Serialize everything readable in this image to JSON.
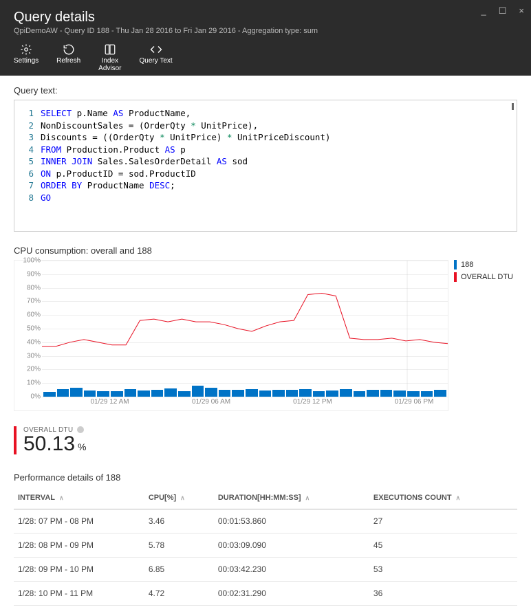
{
  "window": {
    "min": "_",
    "max": "☐",
    "close": "×"
  },
  "header": {
    "title": "Query details",
    "subtitle": "QpiDemoAW - Query ID 188 - Thu Jan 28 2016 to Fri Jan 29 2016 - Aggregation type: sum"
  },
  "toolbar": {
    "settings": "Settings",
    "refresh": "Refresh",
    "index_advisor_l1": "Index",
    "index_advisor_l2": "Advisor",
    "query_text": "Query Text"
  },
  "query_label": "Query text:",
  "code": {
    "l1a": "SELECT",
    "l1b": " p.Name ",
    "l1c": "AS",
    "l1d": " ProductName,",
    "l2a": "    NonDiscountSales = (OrderQty ",
    "l2b": "*",
    "l2c": " UnitPrice),",
    "l3a": "    Discounts = ((OrderQty ",
    "l3b": "*",
    "l3c": " UnitPrice) ",
    "l3d": "*",
    "l3e": " UnitPriceDiscount)",
    "l4a": "FROM",
    "l4b": " Production.Product ",
    "l4c": "AS",
    "l4d": " p",
    "l5a": "INNER JOIN",
    "l5b": " Sales.SalesOrderDetail ",
    "l5c": "AS",
    "l5d": " sod",
    "l6a": "ON",
    "l6b": " p.ProductID = sod.ProductID",
    "l7a": "ORDER BY",
    "l7b": " ProductName ",
    "l7c": "DESC",
    "l7d": ";",
    "l8a": "GO",
    "n1": "1",
    "n2": "2",
    "n3": "3",
    "n4": "4",
    "n5": "5",
    "n6": "6",
    "n7": "7",
    "n8": "8"
  },
  "chart_title": "CPU consumption: overall and 188",
  "legend": {
    "s1_name": "188",
    "s1_color": "#0073c6",
    "s2_name": "OVERALL DTU",
    "s2_color": "#e81123"
  },
  "chart_data": {
    "type": "bar+line",
    "ylabel": "",
    "ylim": [
      0,
      100
    ],
    "x_tick_labels": [
      "01/29 12 AM",
      "01/29 06 AM",
      "01/29 12 PM",
      "01/29 06 PM"
    ],
    "x_tick_positions_pct": [
      16.7,
      41.7,
      66.7,
      91.7
    ],
    "series": [
      {
        "name": "188",
        "type": "bar",
        "values": [
          3.5,
          5.8,
          6.8,
          4.7,
          3.9,
          4.2,
          5.5,
          4.8,
          5.1,
          6.0,
          4.0,
          7.9,
          6.5,
          5.0,
          5.2,
          5.8,
          4.4,
          5.0,
          5.2,
          5.4,
          3.8,
          4.6,
          5.5,
          4.3,
          5.0,
          5.3,
          4.5,
          3.8,
          4.2,
          5.0
        ]
      },
      {
        "name": "OVERALL DTU",
        "type": "line",
        "values": [
          37,
          37,
          40,
          42,
          40,
          38,
          38,
          56,
          57,
          55,
          57,
          55,
          55,
          53,
          50,
          48,
          52,
          55,
          56,
          75,
          76,
          74,
          43,
          42,
          42,
          43,
          41,
          42,
          40,
          39
        ]
      }
    ]
  },
  "big_stat": {
    "label": "OVERALL DTU",
    "value": "50.13",
    "suffix": " %"
  },
  "perf_title": "Performance details of 188",
  "perf_headers": {
    "interval": "INTERVAL",
    "cpu": "CPU[%]",
    "duration": "DURATION[HH:MM:SS]",
    "exec": "EXECUTIONS COUNT"
  },
  "perf_rows": [
    {
      "interval": "1/28: 07 PM - 08 PM",
      "cpu": "3.46",
      "duration": "00:01:53.860",
      "exec": "27"
    },
    {
      "interval": "1/28: 08 PM - 09 PM",
      "cpu": "5.78",
      "duration": "00:03:09.090",
      "exec": "45"
    },
    {
      "interval": "1/28: 09 PM - 10 PM",
      "cpu": "6.85",
      "duration": "00:03:42.230",
      "exec": "53"
    },
    {
      "interval": "1/28: 10 PM - 11 PM",
      "cpu": "4.72",
      "duration": "00:02:31.290",
      "exec": "36"
    }
  ]
}
